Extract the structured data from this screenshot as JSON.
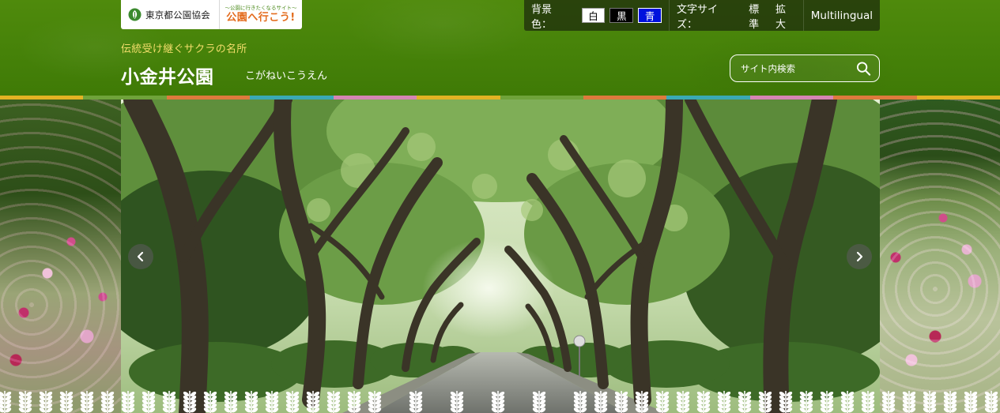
{
  "logos": {
    "association": "東京都公園協会",
    "campaign_small": "〜公園に行きたくなるサイト〜",
    "campaign_big": "公園へ行こう!"
  },
  "toolbar": {
    "bg_label": "背景色：",
    "bg_options": [
      "白",
      "黒",
      "青"
    ],
    "font_label": "文字サイズ：",
    "font_options": [
      "標準",
      "拡大"
    ],
    "language": "Multilingual"
  },
  "site": {
    "tagline": "伝統受け継ぐサクラの名所",
    "title": "小金井公園",
    "reading": "こがねいこうえん"
  },
  "search": {
    "placeholder": "サイト内検索",
    "icon": "search-icon"
  },
  "colors": {
    "header_green": "#468209",
    "tagline_yellow": "#f2dd6b",
    "stripe": [
      "#e2b323",
      "#6fa33a",
      "#de7a3d",
      "#3aa9b5",
      "#d685b4",
      "#e2b323",
      "#6fa33a",
      "#de7a3d",
      "#3aa9b5",
      "#d685b4",
      "#de7a3d",
      "#e2b323"
    ]
  },
  "slider": {
    "prev_icon": "chevron-left-icon",
    "next_icon": "chevron-right-icon"
  }
}
